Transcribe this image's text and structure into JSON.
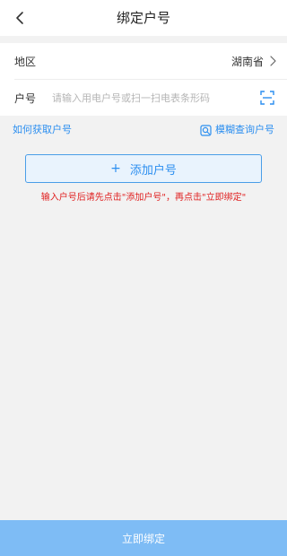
{
  "header": {
    "title": "绑定户号",
    "back_icon": "chevron-left-icon"
  },
  "form": {
    "region": {
      "label": "地区",
      "value": "湖南省",
      "icon": "chevron-right-icon"
    },
    "account": {
      "label": "户号",
      "placeholder": "请输入用电户号或扫一扫电表条形码",
      "value": "",
      "scan_icon": "scan-icon"
    }
  },
  "links": {
    "how_to_get": "如何获取户号",
    "fuzzy_query": "模糊查询户号",
    "fuzzy_icon": "search-icon"
  },
  "add_button": {
    "plus": "+",
    "label": "添加户号"
  },
  "hint": "输入户号后请先点击\"添加户号\"，再点击\"立即绑定\"",
  "submit": {
    "label": "立即绑定"
  },
  "colors": {
    "accent": "#2b8ef0",
    "hint": "#e02020",
    "submit_bg": "#7ebcf5",
    "background": "#f2f2f2"
  }
}
